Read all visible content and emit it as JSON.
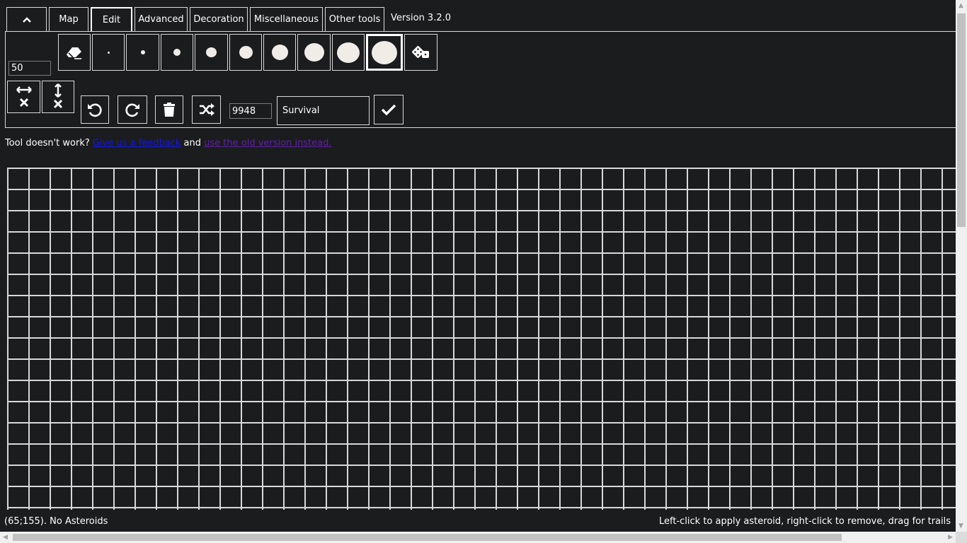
{
  "tabs": {
    "collapse_icon": "chevron-up-icon",
    "items": [
      {
        "label": "Map"
      },
      {
        "label": "Edit"
      },
      {
        "label": "Advanced"
      },
      {
        "label": "Decoration"
      },
      {
        "label": "Miscellaneous"
      },
      {
        "label": "Other tools"
      }
    ],
    "active": "Edit",
    "version": "Version 3.2.0"
  },
  "toolbar": {
    "brush_size_value": "50",
    "brush_tools": [
      {
        "icon": "eraser-icon"
      },
      {
        "icon": "asteroid-size-1-icon"
      },
      {
        "icon": "asteroid-size-2-icon"
      },
      {
        "icon": "asteroid-size-3-icon"
      },
      {
        "icon": "asteroid-size-4-icon"
      },
      {
        "icon": "asteroid-size-5-icon"
      },
      {
        "icon": "asteroid-size-6-icon"
      },
      {
        "icon": "asteroid-size-7-icon"
      },
      {
        "icon": "asteroid-size-8-icon"
      },
      {
        "icon": "asteroid-size-9-icon"
      },
      {
        "icon": "random-dice-icon"
      }
    ],
    "selected_brush": "asteroid-size-9-icon",
    "seed_value": "9948",
    "mode_value": "Survival"
  },
  "info": {
    "prefix": "Tool doesn't work?",
    "feedback_link": "Give us a feedback",
    "middle": "and",
    "old_version_link": "use the old version instead."
  },
  "status": {
    "coordinates": "(65;155). No Asteroids",
    "hint": "Left-click to apply asteroid, right-click to remove, drag for trails"
  },
  "colors": {
    "background": "#1b1c1e",
    "grid_line": "#d8d8d8",
    "link": "#1515e6",
    "visited_link": "#5d20a6"
  }
}
